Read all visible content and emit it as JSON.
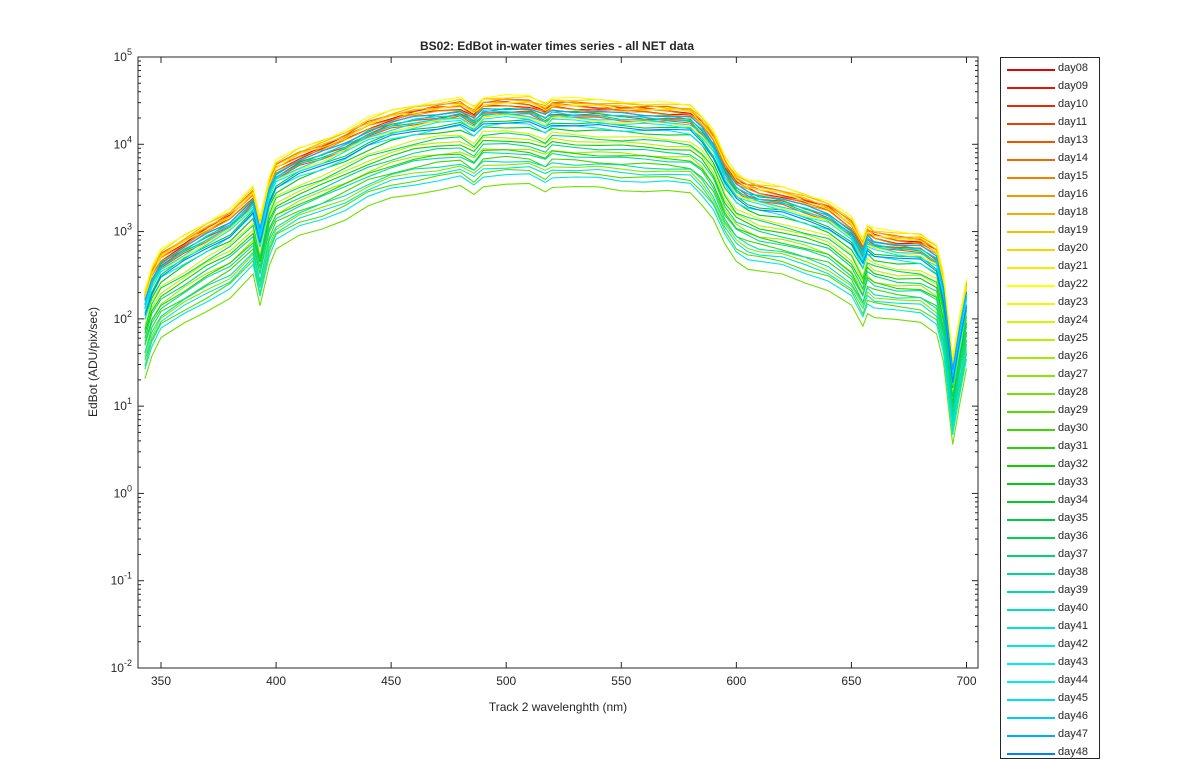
{
  "chart_data": {
    "type": "line",
    "title": "BS02: EdBot in-water times series - all NET data",
    "xlabel": "Track 2 wavelenghth (nm)",
    "ylabel": "EdBot (ADU/pix/sec)",
    "xlim": [
      340,
      705
    ],
    "ylim": [
      0.01,
      100000
    ],
    "yscale": "log",
    "grid": false,
    "legend_position": "outside-right",
    "x_ticks": [
      350,
      400,
      450,
      500,
      550,
      600,
      650,
      700
    ],
    "x_tick_labels": [
      "350",
      "400",
      "450",
      "500",
      "550",
      "600",
      "650",
      "700"
    ],
    "y_ticks": [
      0.01,
      0.1,
      1,
      10,
      100,
      1000,
      10000,
      100000
    ],
    "y_tick_labels": [
      {
        "base": "10",
        "exp": "-2"
      },
      {
        "base": "10",
        "exp": "-1"
      },
      {
        "base": "10",
        "exp": "0"
      },
      {
        "base": "10",
        "exp": "1"
      },
      {
        "base": "10",
        "exp": "2"
      },
      {
        "base": "10",
        "exp": "3"
      },
      {
        "base": "10",
        "exp": "4"
      },
      {
        "base": "10",
        "exp": "5"
      }
    ],
    "series_profile_description": "Each series follows a common spectral shape scaled by a per-day peak value",
    "profile": {
      "x": [
        343,
        346,
        350,
        360,
        370,
        380,
        390,
        393,
        397,
        400,
        410,
        420,
        430,
        440,
        450,
        460,
        470,
        480,
        486,
        490,
        500,
        510,
        517,
        520,
        530,
        540,
        550,
        560,
        570,
        580,
        585,
        590,
        595,
        600,
        605,
        610,
        620,
        630,
        640,
        650,
        655,
        657,
        660,
        670,
        680,
        687,
        690,
        694,
        697,
        700
      ],
      "y": [
        0.006,
        0.011,
        0.017,
        0.025,
        0.036,
        0.05,
        0.09,
        0.04,
        0.12,
        0.18,
        0.25,
        0.31,
        0.4,
        0.55,
        0.68,
        0.78,
        0.86,
        0.93,
        0.75,
        0.97,
        1.0,
        0.98,
        0.82,
        0.95,
        0.92,
        0.9,
        0.86,
        0.84,
        0.82,
        0.78,
        0.6,
        0.4,
        0.2,
        0.13,
        0.11,
        0.1,
        0.09,
        0.075,
        0.062,
        0.04,
        0.023,
        0.034,
        0.03,
        0.027,
        0.026,
        0.02,
        0.009,
        0.001,
        0.003,
        0.008
      ]
    },
    "series": [
      {
        "name": "day08",
        "color": "#e60000",
        "peak": 30000
      },
      {
        "name": "day09",
        "color": "#e61400",
        "peak": 28000
      },
      {
        "name": "day10",
        "color": "#e82a00",
        "peak": 26000
      },
      {
        "name": "day11",
        "color": "#eb4000",
        "peak": 24000
      },
      {
        "name": "day13",
        "color": "#ee5500",
        "peak": 22000
      },
      {
        "name": "day14",
        "color": "#f06a00",
        "peak": 32000
      },
      {
        "name": "day15",
        "color": "#f27f00",
        "peak": 29000
      },
      {
        "name": "day16",
        "color": "#f59400",
        "peak": 27000
      },
      {
        "name": "day18",
        "color": "#f7a900",
        "peak": 33000
      },
      {
        "name": "day19",
        "color": "#f9be00",
        "peak": 31000
      },
      {
        "name": "day20",
        "color": "#fbd300",
        "peak": 35000
      },
      {
        "name": "day21",
        "color": "#fde800",
        "peak": 30000
      },
      {
        "name": "day22",
        "color": "#ffff00",
        "peak": 36000
      },
      {
        "name": "day23",
        "color": "#e8fa00",
        "peak": 21000
      },
      {
        "name": "day24",
        "color": "#d0f500",
        "peak": 14000
      },
      {
        "name": "day25",
        "color": "#b8f000",
        "peak": 12000
      },
      {
        "name": "day26",
        "color": "#a0eb00",
        "peak": 9000
      },
      {
        "name": "day27",
        "color": "#88e600",
        "peak": 6000
      },
      {
        "name": "day28",
        "color": "#70e100",
        "peak": 3500
      },
      {
        "name": "day29",
        "color": "#58dc00",
        "peak": 5000
      },
      {
        "name": "day30",
        "color": "#40d700",
        "peak": 7000
      },
      {
        "name": "day31",
        "color": "#28d200",
        "peak": 8500
      },
      {
        "name": "day32",
        "color": "#10cd00",
        "peak": 11000
      },
      {
        "name": "day33",
        "color": "#00cc10",
        "peak": 16000
      },
      {
        "name": "day34",
        "color": "#00cc28",
        "peak": 19000
      },
      {
        "name": "day35",
        "color": "#00cc40",
        "peak": 23000
      },
      {
        "name": "day36",
        "color": "#00d058",
        "peak": 25000
      },
      {
        "name": "day37",
        "color": "#00d470",
        "peak": 13000
      },
      {
        "name": "day38",
        "color": "#00d888",
        "peak": 10000
      },
      {
        "name": "day39",
        "color": "#00dca0",
        "peak": 8000
      },
      {
        "name": "day40",
        "color": "#00e0b8",
        "peak": 6500
      },
      {
        "name": "day41",
        "color": "#00e4d0",
        "peak": 5500
      },
      {
        "name": "day42",
        "color": "#00e8e0",
        "peak": 4500
      },
      {
        "name": "day43",
        "color": "#00ecec",
        "peak": 17000
      },
      {
        "name": "day44",
        "color": "#00eaf4",
        "peak": 20000
      },
      {
        "name": "day45",
        "color": "#00ddf8",
        "peak": 22000
      },
      {
        "name": "day46",
        "color": "#00ccfc",
        "peak": 24000
      },
      {
        "name": "day47",
        "color": "#00aaff",
        "peak": 26000
      },
      {
        "name": "day48",
        "color": "#0080ff",
        "peak": 18000
      }
    ]
  }
}
